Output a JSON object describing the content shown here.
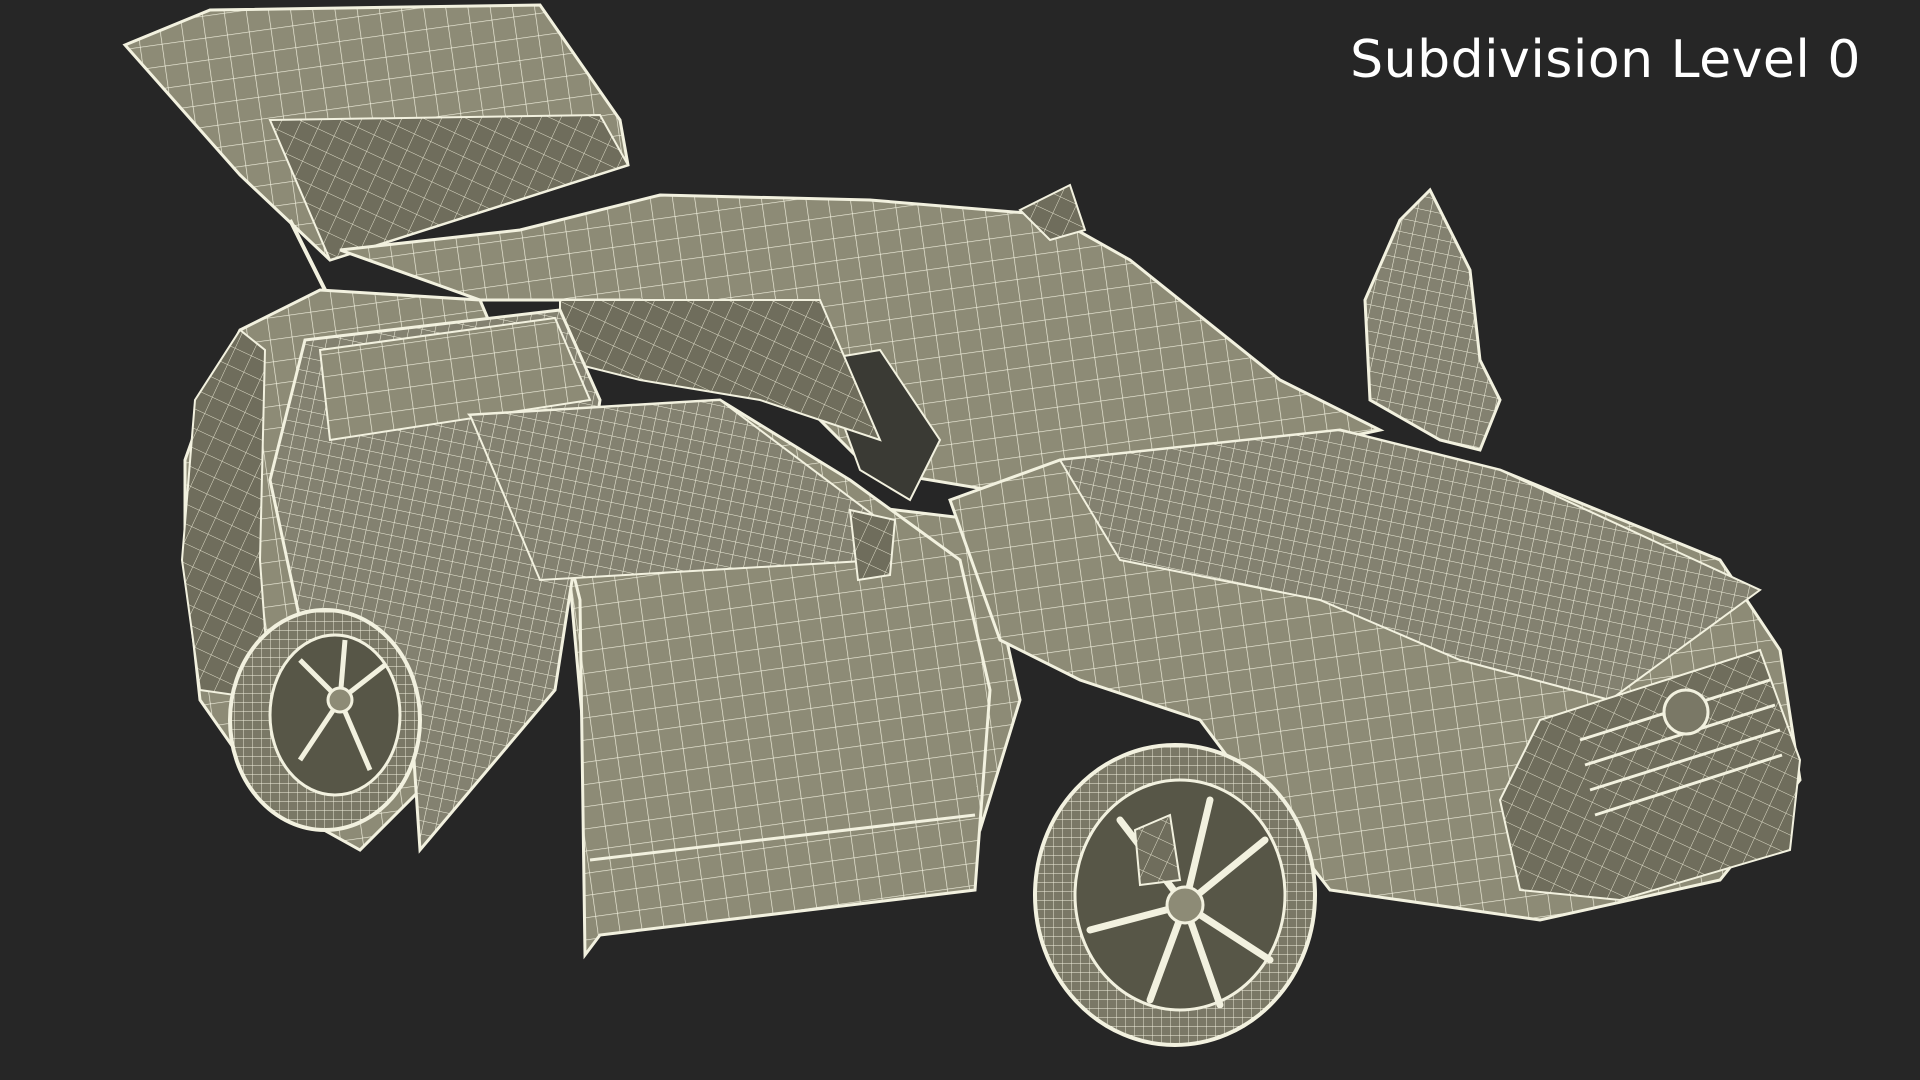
{
  "viewport": {
    "label": "Subdivision Level 0",
    "background_color": "#262626",
    "label_color": "#ffffff"
  },
  "model": {
    "icon": "car-wireframe",
    "shading": "wireframe-on-shaded",
    "fill_color": "#8d8b76",
    "shade_color": "#6f6d5c",
    "wire_color": "#f2f1df",
    "doors_open": [
      "rear-hatch",
      "rear-left-door",
      "front-left-door",
      "front-right-door"
    ]
  }
}
